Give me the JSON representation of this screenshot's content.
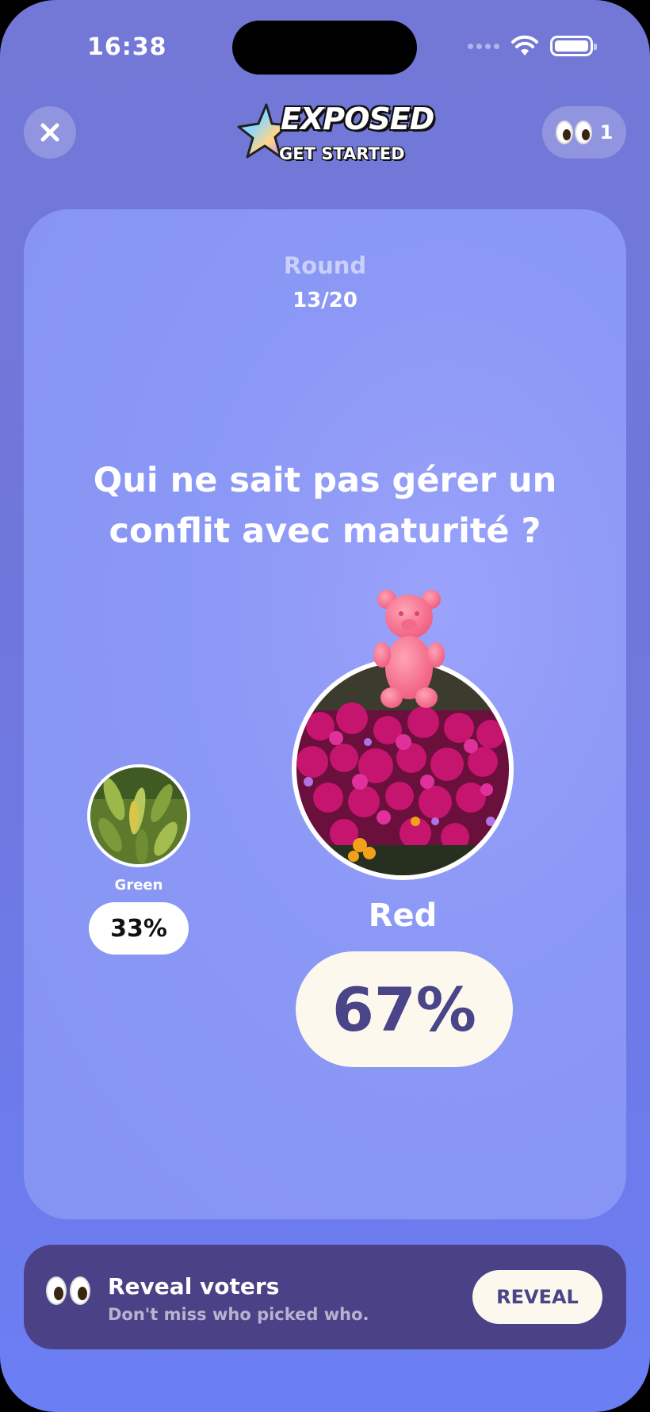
{
  "status_bar": {
    "time": "16:38"
  },
  "header": {
    "logo_title": "EXPOSED",
    "logo_subtitle": "GET STARTED",
    "eyes_count": "1"
  },
  "round": {
    "label": "Round",
    "count": "13/20"
  },
  "question": "Qui ne sait pas gérer un conflit avec maturité ?",
  "options": [
    {
      "label": "Green",
      "percent": "33%",
      "image": "green-leaves-photo"
    },
    {
      "label": "Red",
      "percent": "67%",
      "image": "pink-flowers-photo",
      "winner": true
    }
  ],
  "banner": {
    "title": "Reveal voters",
    "subtitle": "Don't miss who picked who.",
    "button_label": "REVEAL"
  },
  "colors": {
    "background": "#7077dc",
    "card": "#8b98f5",
    "banner": "#4b4186",
    "pill": "#fdf8ee",
    "pill_text": "#4a4488"
  }
}
